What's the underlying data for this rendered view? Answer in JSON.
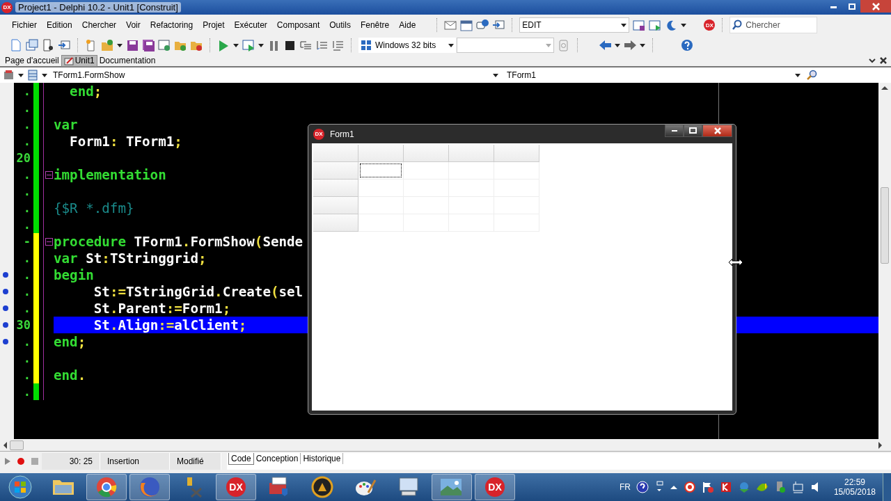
{
  "window": {
    "title": "Project1 - Delphi 10.2 - Unit1 [Construit]",
    "logo": "DX"
  },
  "menu": [
    "Fichier",
    "Edition",
    "Chercher",
    "Voir",
    "Refactoring",
    "Projet",
    "Exécuter",
    "Composant",
    "Outils",
    "Fenêtre",
    "Aide"
  ],
  "layout_combo": {
    "value": "EDIT"
  },
  "toolbar_badge": "DX",
  "search": {
    "placeholder": "Chercher"
  },
  "platform_combo": {
    "value": "Windows 32 bits"
  },
  "tabs": [
    {
      "label": "Page d'accueil",
      "selected": false
    },
    {
      "label": "Unit1",
      "selected": true
    },
    {
      "label": "Documentation",
      "selected": false
    }
  ],
  "editor_nav": {
    "method": "TForm1.FormShow",
    "class": "TForm1"
  },
  "code_lines": [
    {
      "marker": ".",
      "changed": false,
      "executable": false,
      "foldable": false,
      "selected": false,
      "segments": [
        {
          "kind": "keyword",
          "text": "  end"
        },
        {
          "kind": "symbol",
          "text": ";"
        }
      ]
    },
    {
      "marker": ".",
      "changed": false,
      "executable": false,
      "foldable": false,
      "selected": false
    },
    {
      "marker": ".",
      "changed": false,
      "executable": false,
      "foldable": false,
      "selected": false,
      "segments": [
        {
          "kind": "keyword",
          "text": "var"
        }
      ]
    },
    {
      "marker": ".",
      "changed": false,
      "executable": false,
      "foldable": false,
      "selected": false,
      "segments": [
        {
          "kind": "ident",
          "text": "  Form1"
        },
        {
          "kind": "symbol",
          "text": ": "
        },
        {
          "kind": "ident",
          "text": "TForm1"
        },
        {
          "kind": "symbol",
          "text": ";"
        }
      ]
    },
    {
      "marker": "20",
      "changed": false,
      "executable": false,
      "foldable": false,
      "selected": false
    },
    {
      "marker": ".",
      "changed": false,
      "executable": false,
      "foldable": true,
      "selected": false,
      "segments": [
        {
          "kind": "keyword",
          "text": "implementation"
        }
      ]
    },
    {
      "marker": ".",
      "changed": false,
      "executable": false,
      "foldable": false,
      "selected": false
    },
    {
      "marker": ".",
      "changed": false,
      "executable": false,
      "foldable": false,
      "selected": false,
      "segments": [
        {
          "kind": "comment",
          "text": "{$R *.dfm}"
        }
      ]
    },
    {
      "marker": ".",
      "changed": false,
      "executable": false,
      "foldable": false,
      "selected": false
    },
    {
      "marker": "-",
      "changed": true,
      "executable": false,
      "foldable": true,
      "selected": false,
      "segments": [
        {
          "kind": "keyword",
          "text": "procedure "
        },
        {
          "kind": "ident",
          "text": "TForm1"
        },
        {
          "kind": "symbol",
          "text": "."
        },
        {
          "kind": "ident",
          "text": "FormShow"
        },
        {
          "kind": "symbol",
          "text": "("
        },
        {
          "kind": "ident",
          "text": "Sende"
        }
      ]
    },
    {
      "marker": ".",
      "changed": true,
      "executable": false,
      "foldable": false,
      "selected": false,
      "segments": [
        {
          "kind": "keyword",
          "text": "var "
        },
        {
          "kind": "ident",
          "text": "St"
        },
        {
          "kind": "symbol",
          "text": ":"
        },
        {
          "kind": "ident",
          "text": "TStringgrid"
        },
        {
          "kind": "symbol",
          "text": ";"
        }
      ]
    },
    {
      "marker": ".",
      "changed": true,
      "executable": true,
      "foldable": false,
      "selected": false,
      "segments": [
        {
          "kind": "keyword",
          "text": "begin"
        }
      ]
    },
    {
      "marker": ".",
      "changed": true,
      "executable": true,
      "foldable": false,
      "selected": false,
      "segments": [
        {
          "kind": "ident",
          "text": "     St"
        },
        {
          "kind": "symbol",
          "text": ":="
        },
        {
          "kind": "ident",
          "text": "TStringGrid"
        },
        {
          "kind": "symbol",
          "text": "."
        },
        {
          "kind": "ident",
          "text": "Create"
        },
        {
          "kind": "symbol",
          "text": "("
        },
        {
          "kind": "ident",
          "text": "sel"
        }
      ]
    },
    {
      "marker": ".",
      "changed": true,
      "executable": true,
      "foldable": false,
      "selected": false,
      "segments": [
        {
          "kind": "ident",
          "text": "     St"
        },
        {
          "kind": "symbol",
          "text": "."
        },
        {
          "kind": "ident",
          "text": "Parent"
        },
        {
          "kind": "symbol",
          "text": ":="
        },
        {
          "kind": "ident",
          "text": "Form1"
        },
        {
          "kind": "symbol",
          "text": ";"
        }
      ]
    },
    {
      "marker": "30",
      "changed": true,
      "executable": true,
      "foldable": false,
      "selected": true,
      "segments": [
        {
          "kind": "ident",
          "text": "     St"
        },
        {
          "kind": "symbol",
          "text": "."
        },
        {
          "kind": "ident",
          "text": "Align"
        },
        {
          "kind": "symbol",
          "text": ":="
        },
        {
          "kind": "ident",
          "text": "alClient"
        },
        {
          "kind": "symbol",
          "text": ";"
        }
      ]
    },
    {
      "marker": ".",
      "changed": true,
      "executable": true,
      "foldable": false,
      "selected": false,
      "segments": [
        {
          "kind": "keyword",
          "text": "end"
        },
        {
          "kind": "symbol",
          "text": ";"
        }
      ]
    },
    {
      "marker": ".",
      "changed": true,
      "executable": false,
      "foldable": false,
      "selected": false
    },
    {
      "marker": ".",
      "changed": true,
      "executable": false,
      "foldable": false,
      "selected": false,
      "segments": [
        {
          "kind": "keyword",
          "text": "end"
        },
        {
          "kind": "symbol",
          "text": "."
        }
      ]
    },
    {
      "marker": ".",
      "changed": false,
      "executable": false,
      "foldable": false,
      "selected": false
    }
  ],
  "form": {
    "title": "Form1",
    "logo": "DX",
    "grid": {
      "rows": [
        {
          "cells": [
            {
              "kind": "fixed"
            },
            {
              "kind": "fixed"
            },
            {
              "kind": "fixed"
            },
            {
              "kind": "fixed"
            },
            {
              "kind": "fixed"
            }
          ]
        },
        {
          "cells": [
            {
              "kind": "fixed"
            },
            {
              "kind": "cell",
              "focused": true
            },
            {
              "kind": "cell",
              "focused": false
            },
            {
              "kind": "cell",
              "focused": false
            },
            {
              "kind": "cell",
              "focused": false
            }
          ]
        },
        {
          "cells": [
            {
              "kind": "fixed"
            },
            {
              "kind": "cell",
              "focused": false
            },
            {
              "kind": "cell",
              "focused": false
            },
            {
              "kind": "cell",
              "focused": false
            },
            {
              "kind": "cell",
              "focused": false
            }
          ]
        },
        {
          "cells": [
            {
              "kind": "fixed"
            },
            {
              "kind": "cell",
              "focused": false
            },
            {
              "kind": "cell",
              "focused": false
            },
            {
              "kind": "cell",
              "focused": false
            },
            {
              "kind": "cell",
              "focused": false
            }
          ]
        },
        {
          "cells": [
            {
              "kind": "fixed"
            },
            {
              "kind": "cell",
              "focused": false
            },
            {
              "kind": "cell",
              "focused": false
            },
            {
              "kind": "cell",
              "focused": false
            },
            {
              "kind": "cell",
              "focused": false
            }
          ]
        }
      ]
    }
  },
  "status_bar": {
    "position": "30: 25",
    "mode": "Insertion",
    "state": "Modifié"
  },
  "view_tabs": [
    {
      "label": "Code",
      "selected": true
    },
    {
      "label": "Conception",
      "selected": false
    },
    {
      "label": "Historique",
      "selected": false
    }
  ],
  "taskbar": {
    "apps": [
      {
        "kind": "folder",
        "active": false
      },
      {
        "kind": "browser",
        "active": true
      },
      {
        "kind": "fox",
        "active": true
      },
      {
        "kind": "tools",
        "active": false
      },
      {
        "kind": "dx",
        "label": "DX",
        "active": true
      },
      {
        "kind": "toolbox",
        "active": false
      },
      {
        "kind": "player",
        "active": false
      },
      {
        "kind": "paint",
        "active": false
      },
      {
        "kind": "keyboard",
        "active": false
      },
      {
        "kind": "picture",
        "active": true
      },
      {
        "kind": "dx",
        "label": "DX",
        "active": true
      }
    ],
    "language": "FR",
    "time": "22:59",
    "date": "15/05/2018"
  }
}
